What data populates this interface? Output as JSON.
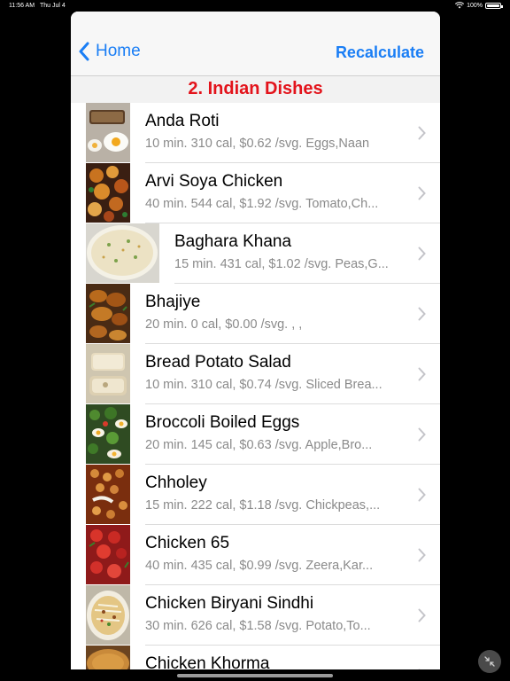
{
  "status_bar": {
    "time": "11:56 AM",
    "date": "Thu Jul 4",
    "battery": "100%"
  },
  "nav": {
    "back_label": "Home",
    "action_label": "Recalculate"
  },
  "section_title": "2. Indian Dishes",
  "dishes": [
    {
      "title": "Anda Roti",
      "subtitle": "10 min. 310 cal, $0.62 /svg. Eggs,Naan"
    },
    {
      "title": "Arvi Soya Chicken",
      "subtitle": "40 min. 544 cal, $1.92 /svg. Tomato,Ch..."
    },
    {
      "title": "Baghara Khana",
      "subtitle": "15 min. 431 cal, $1.02 /svg. Peas,G..."
    },
    {
      "title": "Bhajiye",
      "subtitle": "20 min. 0 cal, $0.00 /svg.  , ,"
    },
    {
      "title": "Bread Potato Salad",
      "subtitle": "10 min. 310 cal, $0.74 /svg. Sliced Brea..."
    },
    {
      "title": "Broccoli Boiled Eggs",
      "subtitle": "20 min. 145 cal, $0.63 /svg. Apple,Bro..."
    },
    {
      "title": "Chholey",
      "subtitle": "15 min. 222 cal, $1.18 /svg. Chickpeas,..."
    },
    {
      "title": "Chicken 65",
      "subtitle": "40 min. 435 cal, $0.99 /svg. Zeera,Kar..."
    },
    {
      "title": "Chicken Biryani Sindhi",
      "subtitle": "30 min. 626 cal, $1.58 /svg. Potato,To..."
    },
    {
      "title": "Chicken Khorma",
      "subtitle": ""
    }
  ],
  "colors": {
    "accent": "#1a7ef5",
    "section_title": "#e3131b"
  }
}
